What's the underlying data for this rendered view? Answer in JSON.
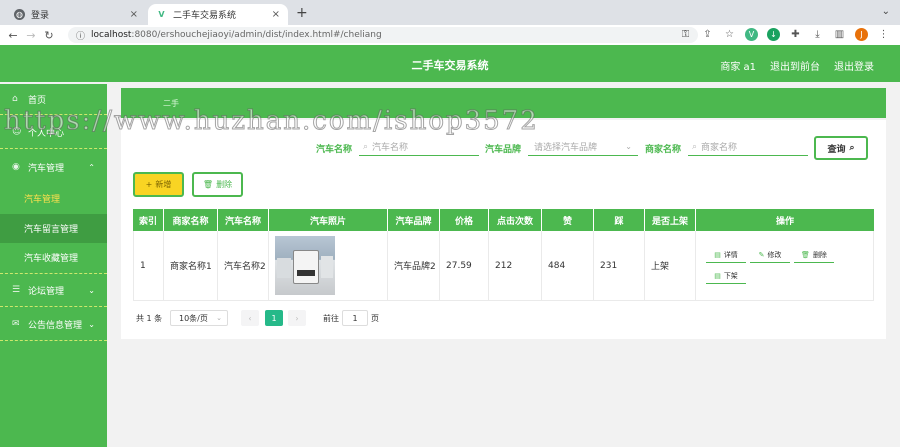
{
  "browser": {
    "tabs": [
      {
        "title": "登录",
        "favicon": "globe-icon",
        "close": "×"
      },
      {
        "title": "二手车交易系统",
        "favicon": "vue-icon",
        "close": "×"
      }
    ],
    "new_tab": "+",
    "tab_menu": "⌄",
    "nav": {
      "back": "←",
      "forward": "→",
      "reload": "↻",
      "security": "ⓘ"
    },
    "url_host": "localhost",
    "url_rest": ":8080/ershouchejiaoyi/admin/dist/index.html#/cheliang",
    "profile_initial": "J",
    "colors": {
      "profile": "#e8710a"
    }
  },
  "header": {
    "title": "二手车交易系统",
    "links": [
      "商家 a1",
      "退出到前台",
      "退出登录"
    ]
  },
  "sidebar": {
    "items": [
      {
        "label": "首页",
        "icon": "home-icon"
      },
      {
        "label": "个人中心",
        "icon": "user-icon"
      },
      {
        "label": "汽车管理",
        "icon": "car-icon",
        "expanded": true
      },
      {
        "label": "论坛管理",
        "icon": "forum-icon"
      },
      {
        "label": "公告信息管理",
        "icon": "notice-icon"
      }
    ],
    "sub_items": [
      {
        "label": "汽车管理",
        "active": true
      },
      {
        "label": "汽车留言管理",
        "active": false
      },
      {
        "label": "汽车收藏管理",
        "active": false
      }
    ]
  },
  "breadcrumb": "二手",
  "search": {
    "car_name_label": "汽车名称",
    "car_name_placeholder": "汽车名称",
    "brand_label": "汽车品牌",
    "brand_placeholder": "请选择汽车品牌",
    "merchant_label": "商家名称",
    "merchant_placeholder": "商家名称",
    "query_label": "查询"
  },
  "actions": {
    "add": "新增",
    "delete": "删除"
  },
  "table": {
    "columns": [
      "索引",
      "商家名称",
      "汽车名称",
      "汽车照片",
      "汽车品牌",
      "价格",
      "点击次数",
      "赞",
      "踩",
      "是否上架",
      "操作"
    ],
    "rows": [
      {
        "index": "1",
        "merchant": "商家名称1",
        "car_name": "汽车名称2",
        "brand": "汽车品牌2",
        "price": "27.59",
        "clicks": "212",
        "likes": "484",
        "dislikes": "231",
        "status": "上架",
        "ops": [
          "详情",
          "修改",
          "删除",
          "下架"
        ]
      }
    ]
  },
  "pagination": {
    "total": "共 1 条",
    "page_size": "10条/页",
    "prev": "‹",
    "next": "›",
    "current": "1",
    "goto_label": "前往",
    "goto_value": "1",
    "page_unit": "页"
  },
  "watermark": "https://www.huzhan.com/ishop3572",
  "colors": {
    "primary": "#4cb84f",
    "warning": "#f9d423",
    "page_active": "#26b989"
  }
}
